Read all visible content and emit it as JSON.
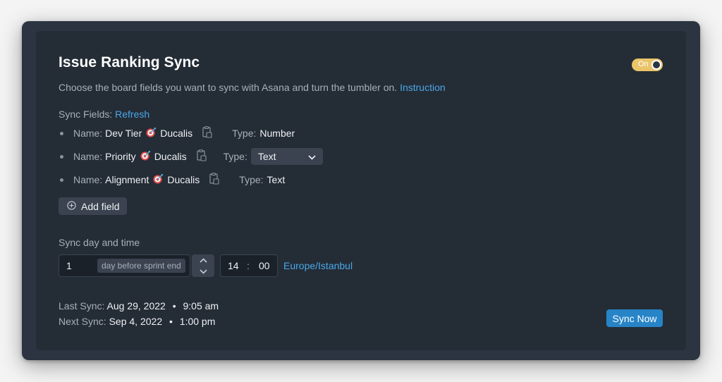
{
  "header": {
    "title": "Issue Ranking Sync",
    "toggle_label": "On",
    "toggle_state": "on",
    "description": "Choose the board fields you want to sync with Asana and turn the tumbler on.",
    "instruction_link": "Instruction"
  },
  "sync_fields": {
    "label": "Sync Fields:",
    "refresh_link": "Refresh",
    "name_label": "Name:",
    "type_label": "Type:",
    "items": [
      {
        "name": "Dev Tier",
        "source": "Ducalis",
        "type": "Number",
        "type_is_select": false
      },
      {
        "name": "Priority",
        "source": "Ducalis",
        "type": "Text",
        "type_is_select": true
      },
      {
        "name": "Alignment",
        "source": "Ducalis",
        "type": "Text",
        "type_is_select": false
      }
    ],
    "add_field_label": "Add field"
  },
  "schedule": {
    "label": "Sync day and time",
    "day_value": "1",
    "day_suffix": "day before sprint end",
    "hour": "14",
    "separator": ":",
    "minute": "00",
    "timezone": "Europe/Istanbul"
  },
  "status": {
    "last_label": "Last Sync:",
    "last_date": "Aug 29, 2022",
    "last_time": "9:05 am",
    "next_label": "Next Sync:",
    "next_date": "Sep 4, 2022",
    "next_time": "1:00 pm",
    "dot": "•",
    "sync_now_label": "Sync Now"
  },
  "colors": {
    "panel": "#242c36",
    "accent_link": "#4aa8e8",
    "toggle": "#e9c469",
    "button_primary": "#2784c7"
  }
}
